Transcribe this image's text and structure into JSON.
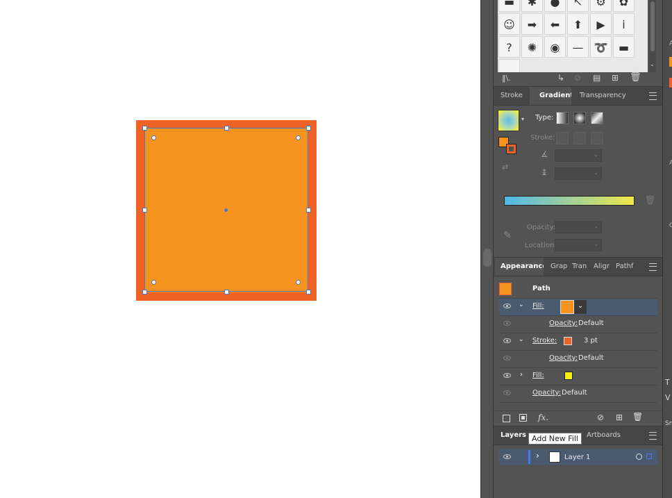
{
  "colors": {
    "canvas_bg": "#ffffff",
    "fill_orange": "#f6931f",
    "stroke_orange": "#ef6426",
    "selection_blue": "#4a78c8",
    "fill_yellow": "#f3ee14",
    "gradient_start": "#4fb8ea",
    "gradient_end": "#f0e74a",
    "panel_bg": "#535353"
  },
  "symbols": {
    "icons": [
      "blue-banner-icon",
      "splat-icon",
      "orange-orb-icon",
      "arrow-cursor-icon",
      "chain-icon",
      "flower-icon",
      "face-icon",
      "arrow-right-icon",
      "arrow-left-icon",
      "arrow-up-icon",
      "play-icon",
      "info-icon",
      "question-icon",
      "blob-icon",
      "globe-icon",
      "dash-icon",
      "swirl-icon",
      "green-bar-icon"
    ],
    "glyphs": [
      "▬",
      "✱",
      "●",
      "↖",
      "⚙",
      "✿",
      "☺",
      "➡",
      "⬅",
      "⬆",
      "▶",
      "i",
      "?",
      "✺",
      "◉",
      "—",
      "➰",
      "▬"
    ]
  },
  "gradient": {
    "tabs": [
      "Stroke",
      "Gradient",
      "Transparency"
    ],
    "type_label": "Type:",
    "stroke_label": "Stroke:",
    "opacity_label": "Opacity:",
    "location_label": "Location:"
  },
  "appearance": {
    "tabs": [
      "Appearance",
      "Grap",
      "Tran",
      "Aligr",
      "Pathf"
    ],
    "title": "Path",
    "rows": [
      {
        "label": "Fill:",
        "value": ""
      },
      {
        "label": "Opacity:",
        "value": "Default"
      },
      {
        "label": "Stroke:",
        "value": "3 pt"
      },
      {
        "label": "Opacity:",
        "value": "Default"
      },
      {
        "label": "Fill:",
        "value": ""
      },
      {
        "label": "Opacity:",
        "value": "Default"
      }
    ],
    "fx_label": "fx."
  },
  "layers": {
    "tabs": [
      "Layers",
      "Artboards"
    ],
    "layer_name": "Layer 1"
  },
  "tooltip": "Add New Fill",
  "right_dock": {
    "letters": [
      "A",
      "A",
      "C",
      "T",
      "V",
      "Sn"
    ]
  }
}
